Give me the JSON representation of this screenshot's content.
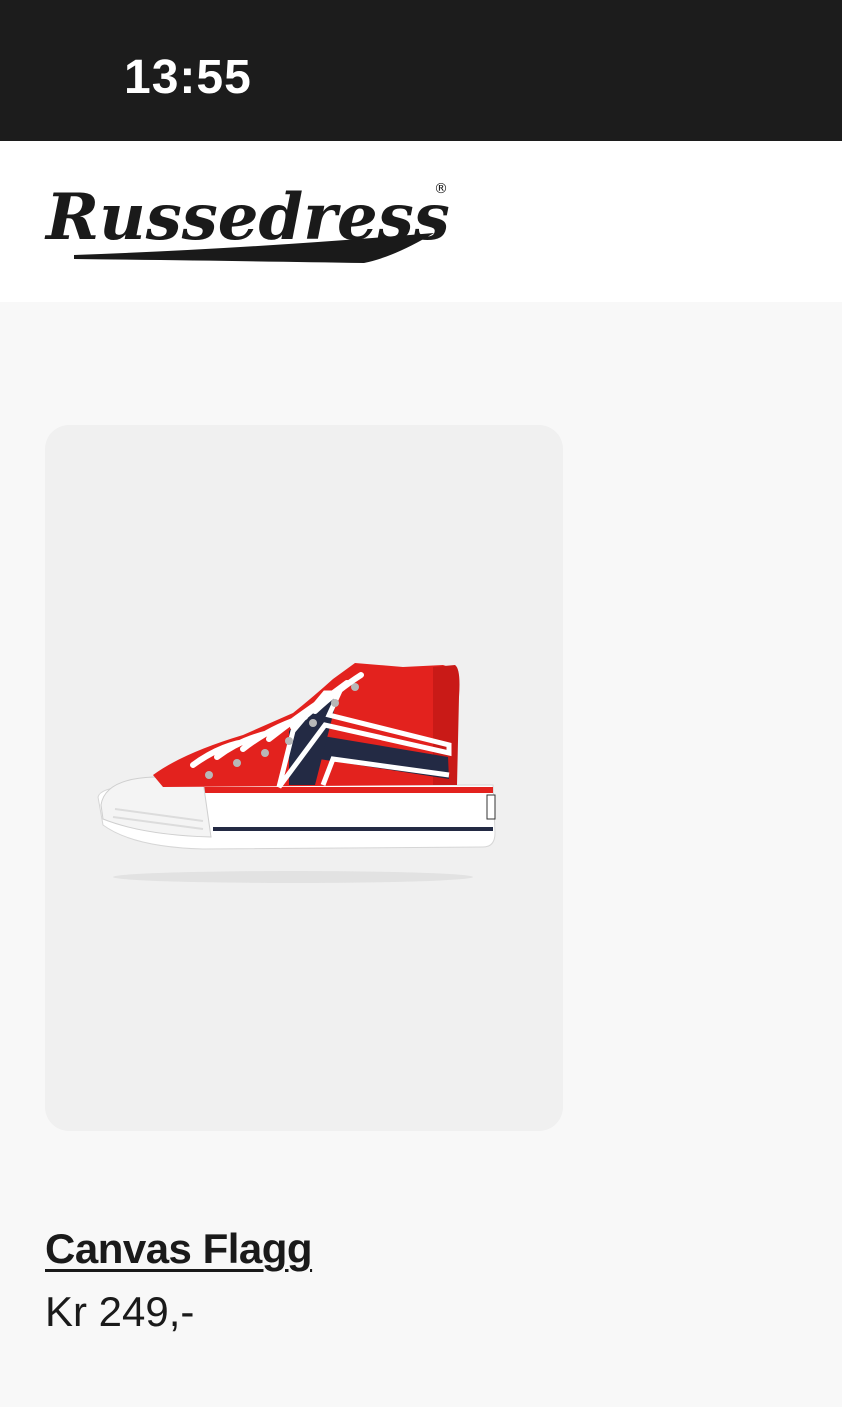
{
  "status_bar": {
    "time": "13:55"
  },
  "header": {
    "logo_text": "Russedress",
    "logo_mark": "®"
  },
  "product": {
    "name": "Canvas Flagg",
    "price": "Kr 249,-",
    "image_icon": "red-high-top-sneaker-image"
  },
  "colors": {
    "status_bar_bg": "#1c1c1c",
    "page_bg": "#f8f8f8",
    "card_bg": "#f0f0f0",
    "shoe_red": "#e3221e",
    "shoe_navy": "#232a44",
    "text": "#1a1a1a"
  }
}
